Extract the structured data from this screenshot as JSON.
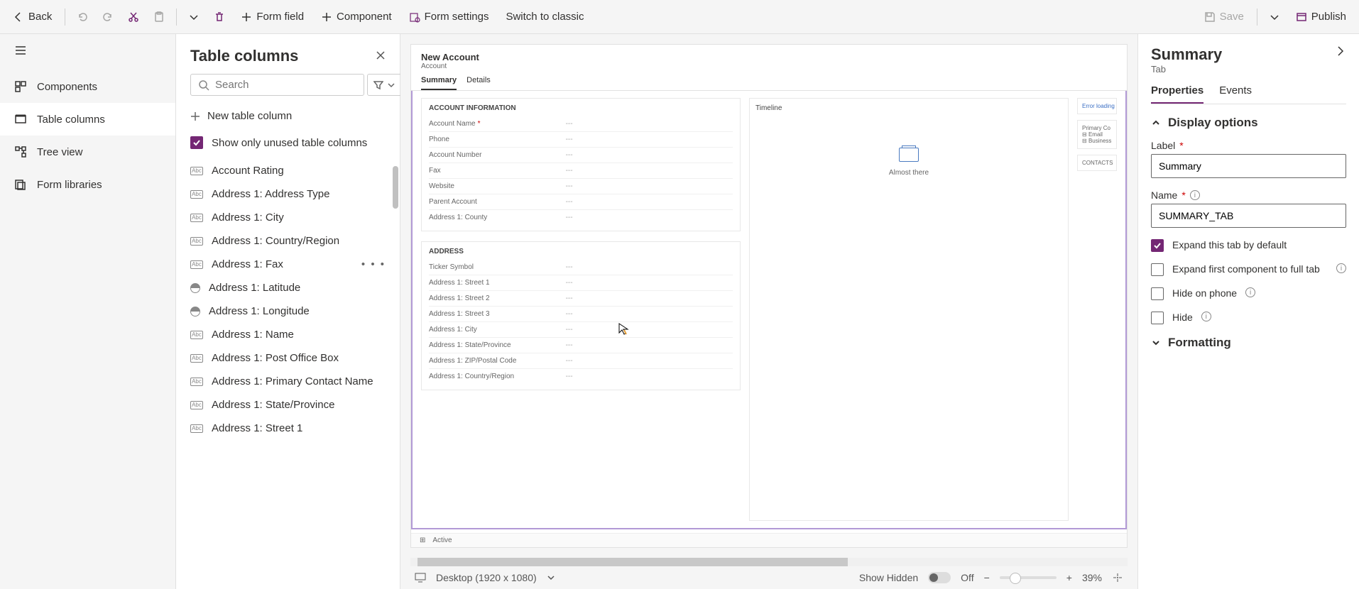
{
  "topbar": {
    "back": "Back",
    "form_field": "Form field",
    "component": "Component",
    "form_settings": "Form settings",
    "switch_classic": "Switch to classic",
    "save": "Save",
    "publish": "Publish"
  },
  "leftrail": {
    "components": "Components",
    "table_columns": "Table columns",
    "tree_view": "Tree view",
    "form_libraries": "Form libraries"
  },
  "colpane": {
    "title": "Table columns",
    "search_placeholder": "Search",
    "new_col": "New table column",
    "show_unused": "Show only unused table columns",
    "items": [
      "Account Rating",
      "Address 1: Address Type",
      "Address 1: City",
      "Address 1: Country/Region",
      "Address 1: Fax",
      "Address 1: Latitude",
      "Address 1: Longitude",
      "Address 1: Name",
      "Address 1: Post Office Box",
      "Address 1: Primary Contact Name",
      "Address 1: State/Province",
      "Address 1: Street 1"
    ]
  },
  "form": {
    "title": "New Account",
    "subtitle": "Account",
    "tabs": {
      "summary": "Summary",
      "details": "Details"
    },
    "section_account_info": "ACCOUNT INFORMATION",
    "section_address": "ADDRESS",
    "section_timeline": "Timeline",
    "timeline_text": "Almost there",
    "right_error": "Error loading",
    "right_primary": "Primary Co",
    "right_email": "Email",
    "right_business": "Business",
    "right_contacts": "CONTACTS",
    "acct_fields": [
      {
        "label": "Account Name",
        "req": true
      },
      {
        "label": "Phone",
        "req": false
      },
      {
        "label": "Account Number",
        "req": false
      },
      {
        "label": "Fax",
        "req": false
      },
      {
        "label": "Website",
        "req": false
      },
      {
        "label": "Parent Account",
        "req": false
      },
      {
        "label": "Address 1: County",
        "req": false
      }
    ],
    "addr_fields": [
      {
        "label": "Ticker Symbol"
      },
      {
        "label": "Address 1: Street 1"
      },
      {
        "label": "Address 1: Street 2"
      },
      {
        "label": "Address 1: Street 3"
      },
      {
        "label": "Address 1: City"
      },
      {
        "label": "Address 1: State/Province"
      },
      {
        "label": "Address 1: ZIP/Postal Code"
      },
      {
        "label": "Address 1: Country/Region"
      }
    ],
    "footer_status": "Active"
  },
  "statusbar": {
    "device": "Desktop (1920 x 1080)",
    "show_hidden": "Show Hidden",
    "toggle_off": "Off",
    "zoom": "39%"
  },
  "prop": {
    "title": "Summary",
    "subtitle": "Tab",
    "tab_properties": "Properties",
    "tab_events": "Events",
    "group_display": "Display options",
    "label_label": "Label",
    "label_value": "Summary",
    "name_label": "Name",
    "name_value": "SUMMARY_TAB",
    "expand_default": "Expand this tab by default",
    "expand_first": "Expand first component to full tab",
    "hide_phone": "Hide on phone",
    "hide": "Hide",
    "group_formatting": "Formatting"
  }
}
